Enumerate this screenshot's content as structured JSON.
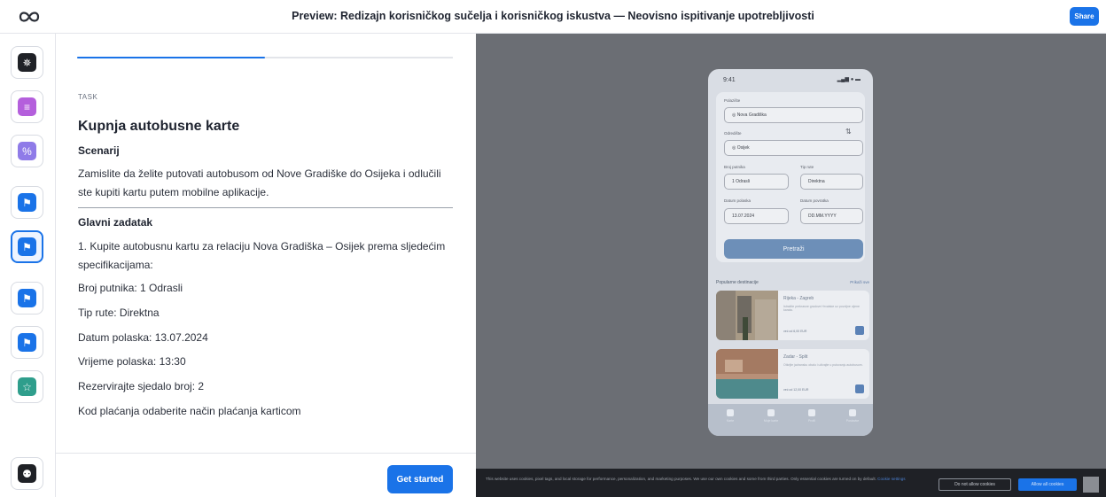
{
  "topbar": {
    "logo_icon": "link-infinity-icon",
    "title": "Preview: Redizajn korisničkog sučelja i korisničkog iskustva — Neovisno ispitivanje upotrebljivosti",
    "share_label": "Share"
  },
  "rail": {
    "items": [
      {
        "icon": "gear-icon",
        "color": "#1f2126",
        "glyph": "✵"
      },
      {
        "icon": "message-icon",
        "color": "#b45fdc",
        "glyph": "≡"
      },
      {
        "icon": "percent-icon",
        "color": "#8f7be8",
        "glyph": "%"
      },
      {
        "icon": "flag-icon",
        "color": "#1a73e8",
        "glyph": "⚑"
      },
      {
        "icon": "flag-icon",
        "color": "#1a73e8",
        "glyph": "⚑",
        "active": true
      },
      {
        "icon": "flag-icon",
        "color": "#1a73e8",
        "glyph": "⚑"
      },
      {
        "icon": "flag-icon",
        "color": "#1a73e8",
        "glyph": "⚑"
      },
      {
        "icon": "star-icon",
        "color": "#2f9e8c",
        "glyph": "☆"
      },
      {
        "icon": "lightbulb-icon",
        "color": "#1f2126",
        "glyph": "⚉"
      }
    ]
  },
  "task": {
    "progress": 0.5,
    "label": "TASK",
    "title": "Kupnja autobusne karte",
    "scenario_heading": "Scenarij",
    "scenario_text": "Zamislite da želite putovati autobusom od Nove Gradiške do Osijeka i odlučili ste kupiti kartu putem mobilne aplikacije.",
    "main_heading": "Glavni zadatak",
    "step_text": "1. Kupite autobusnu kartu za relaciju Nova Gradiška – Osijek prema sljedećim specifikacijama:",
    "specs": [
      "Broj putnika: 1 Odrasli",
      "Tip rute: Direktna",
      "Datum polaska: 13.07.2024",
      "Vrijeme polaska: 13:30",
      "Rezervirajte sjedalo broj: 2",
      "Kod plaćanja odaberite način plaćanja karticom"
    ],
    "start_label": "Get started"
  },
  "phone": {
    "time": "9:41",
    "signal": "▂▄▆ ● ▬",
    "from_label": "Polazište",
    "from_value": "◎  Nova Gradiška",
    "to_label": "Odredište",
    "to_value": "◎  Osijek",
    "swap_icon": "⇅",
    "passengers_label": "Broj putnika",
    "passengers_value": "1 Odrasli",
    "route_label": "Tip rute",
    "route_value": "Direktna",
    "depart_label": "Datum polaska",
    "depart_value": "13.07.2024",
    "return_label": "Datum povratka",
    "return_value": "DD.MM.YYYY",
    "search_label": "Pretraži",
    "popular_title": "Popularne destinacije",
    "popular_link": "Prikaži sve",
    "routes": [
      {
        "name": "Rijeka - Zagreb",
        "desc": "Istražite prekrasne gradove Hrvatske uz povoljne cijene karata.",
        "price": "već od 6,00 EUR"
      },
      {
        "name": "Zadar - Split",
        "desc": "Otkrijte jadransku obalu i uživajte u putovanju autobusom.",
        "price": "već od 12,00 EUR"
      }
    ],
    "tabs": [
      "Karte",
      "Moje karte",
      "Profil",
      "Postavke"
    ]
  },
  "cookie": {
    "text": "This website uses cookies, pixel tags, and local storage for performance, personalization, and marketing purposes. We use our own cookies and some from third parties. Only essential cookies are turned on by default.",
    "link": "Cookie settings",
    "deny_label": "Do not allow cookies",
    "allow_label": "Allow all cookies"
  }
}
